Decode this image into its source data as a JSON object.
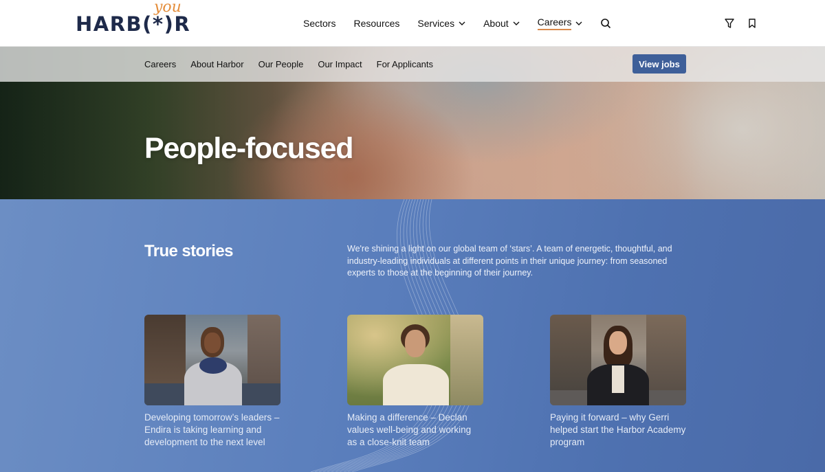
{
  "header": {
    "logo_text": "HARB(*)R",
    "logo_tagline": "you",
    "nav": [
      {
        "label": "Sectors",
        "has_dropdown": false,
        "active": false
      },
      {
        "label": "Resources",
        "has_dropdown": false,
        "active": false
      },
      {
        "label": "Services",
        "has_dropdown": true,
        "active": false
      },
      {
        "label": "About",
        "has_dropdown": true,
        "active": false
      },
      {
        "label": "Careers",
        "has_dropdown": true,
        "active": true
      }
    ],
    "icons": [
      "search-icon",
      "filter-icon",
      "bookmark-icon"
    ],
    "accent_color": "#d98a4c"
  },
  "subnav": {
    "items": [
      "Careers",
      "About Harbor",
      "Our People",
      "Our Impact",
      "For Applicants"
    ],
    "cta_label": "View jobs",
    "cta_color": "#3e5f99"
  },
  "hero": {
    "title": "People-focused"
  },
  "stories": {
    "title": "True stories",
    "description": "We're shining a light on our global team of ‘stars’. A team of energetic, thoughtful, and industry-leading individuals at different points in their unique journey: from seasoned experts to those at the beginning of their journey.",
    "background_color": "#5a7ebc",
    "cards": [
      {
        "caption": "Developing tomorrow’s leaders – Endira is taking learning and development to the next level"
      },
      {
        "caption": "Making a difference – Declan values well-being and working as a close-knit team"
      },
      {
        "caption": "Paying it forward – why Gerri helped start the Harbor Academy program"
      }
    ]
  }
}
